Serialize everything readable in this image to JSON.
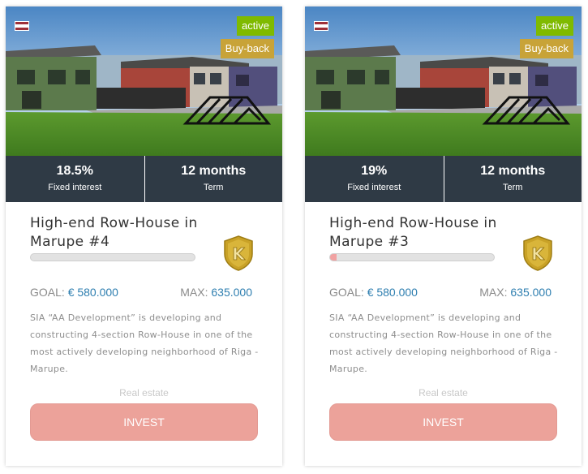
{
  "colors": {
    "active_badge": "#7fba00",
    "buyback_badge": "#c8a338",
    "stats_bar": "#2f3a45",
    "invest_button": "#eca29a",
    "money_value": "#2f7fb0",
    "progress_fill": "#f1a2a2",
    "flag_red": "#9e3039",
    "flag_white": "#ffffff"
  },
  "cards": [
    {
      "flag_icon": "latvia-flag-icon",
      "status_badge": "active",
      "buyback_badge": "Buy-back",
      "interest_value": "18.5%",
      "interest_label": "Fixed interest",
      "term_value": "12 months",
      "term_label": "Term",
      "title": "High-end Row-House in Marupe #4",
      "progress_percent": 0,
      "rating_icon": "shield-rating-icon",
      "goal_label": "GOAL:",
      "goal_value": "€ 580.000",
      "max_label": "MAX:",
      "max_value": "635.000",
      "description": "SIA “AA Development” is developing and constructing 4-section Row-House in one of the most actively developing neighborhood of Riga - Marupe.",
      "category": "Real estate",
      "invest_label": "INVEST"
    },
    {
      "flag_icon": "latvia-flag-icon",
      "status_badge": "active",
      "buyback_badge": "Buy-back",
      "interest_value": "19%",
      "interest_label": "Fixed interest",
      "term_value": "12 months",
      "term_label": "Term",
      "title": "High-end Row-House in Marupe #3",
      "progress_percent": 4,
      "rating_icon": "shield-rating-icon",
      "goal_label": "GOAL:",
      "goal_value": "€ 580.000",
      "max_label": "MAX:",
      "max_value": "635.000",
      "description": "SIA “AA Development” is developing and constructing 4-section Row-House in one of the most actively developing neighborhood of Riga - Marupe.",
      "category": "Real estate",
      "invest_label": "INVEST"
    }
  ]
}
